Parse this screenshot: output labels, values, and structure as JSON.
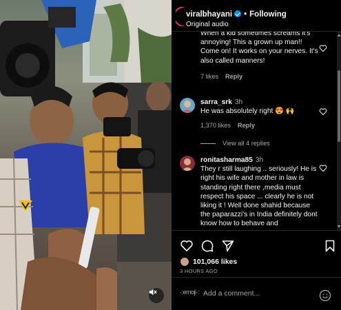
{
  "header": {
    "username": "viralbhayani",
    "separator": "•",
    "follow_status": "Following",
    "subtitle": "Original audio"
  },
  "comments": [
    {
      "username": "",
      "time": "",
      "text": "When a kid sometimes screams it's annoying! This a grown up man!! Come on! It works on your nerves. It's also called manners!",
      "likes": "7 likes",
      "reply_label": "Reply"
    },
    {
      "username": "sarra_srk",
      "time": "3h",
      "text": "He was absolutely right 😍 🙌",
      "likes": "1,370 likes",
      "reply_label": "Reply"
    },
    {
      "username": "ronitasharma85",
      "time": "3h",
      "text": "They r still laughing .. seriously! He is right his wife and mother in law is standing right there ,media must respect his space ... clearly he is not liking it ! Well done shahid because the paparazzi's in India definitely dont know how to behave and"
    }
  ],
  "view_replies": "View all 4 replies",
  "post": {
    "likes": "101,066 likes",
    "time_ago": "3 HOURS AGO"
  },
  "add_comment": {
    "emoji_label": "·:emoji·:",
    "placeholder": "Add a comment..."
  },
  "icons": {
    "like": "heart-icon",
    "comment": "comment-icon",
    "share": "share-icon",
    "save": "bookmark-icon",
    "mute": "muted-speaker-icon",
    "emoji": "smile-icon"
  },
  "colors": {
    "background": "#000000",
    "text": "#f5f5f5",
    "secondary_text": "#a8a8a8",
    "verified": "#0095f6",
    "divider": "#262626"
  }
}
